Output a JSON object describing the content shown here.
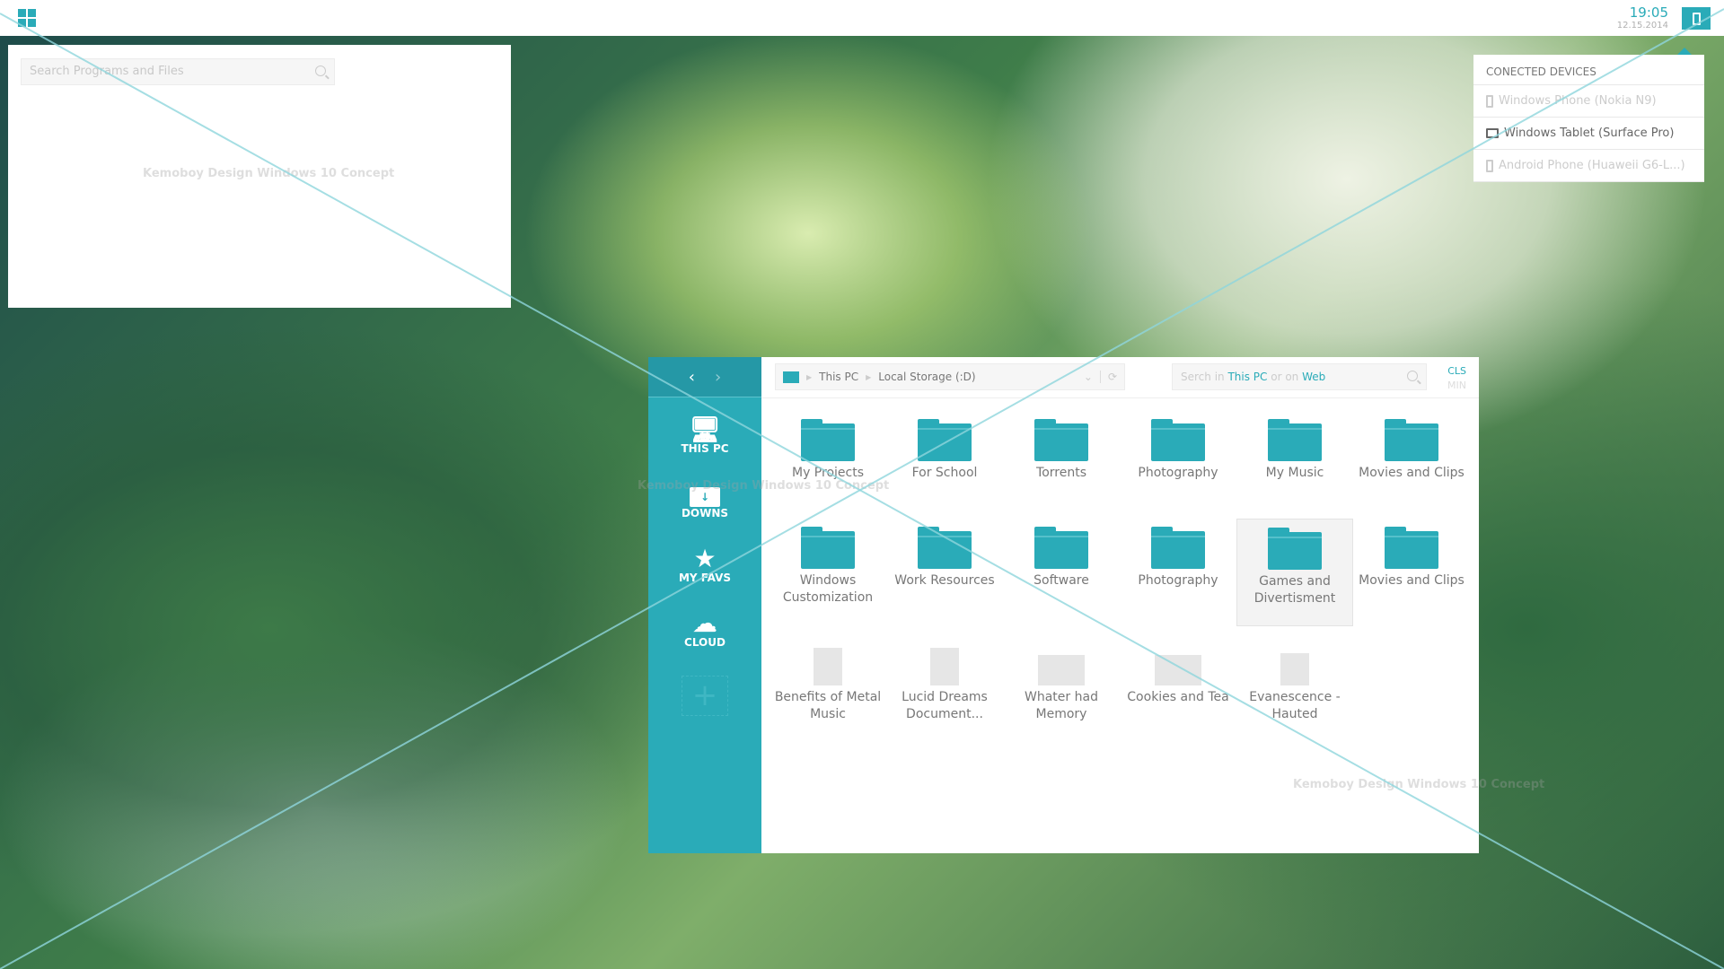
{
  "taskbar": {
    "start_icon": "windows-logo-icon",
    "time": "19:05",
    "date": "12.15.2014",
    "devices_icon": "phone-icon"
  },
  "start_panel": {
    "search_placeholder": "Search Programs and Files",
    "watermark": "Kemoboy Design Windows 10 Concept"
  },
  "devices": {
    "title": "CONECTED DEVICES",
    "items": [
      {
        "label": "Windows Phone (Nokia N9)",
        "icon": "phone-icon",
        "active": false
      },
      {
        "label": "Windows Tablet (Surface Pro)",
        "icon": "tablet-icon",
        "active": true
      },
      {
        "label": "Android Phone (Huaweii G6-L...)",
        "icon": "phone-icon",
        "active": false
      }
    ]
  },
  "explorer": {
    "sidebar": [
      {
        "label": "THIS PC",
        "icon": "computer-icon"
      },
      {
        "label": "DOWNS",
        "icon": "download-folder-icon"
      },
      {
        "label": "MY FAVS",
        "icon": "star-icon"
      },
      {
        "label": "CLOUD",
        "icon": "cloud-icon"
      }
    ],
    "add_label": "+",
    "breadcrumb": [
      "This PC",
      "Local Storage (:D)"
    ],
    "search": {
      "prefix": "Serch in",
      "scope1": "This PC",
      "mid": "or on",
      "scope2": "Web"
    },
    "close_label": "CLS",
    "min_label": "MIN",
    "folders": [
      "My Projects",
      "For School",
      "Torrents",
      "Photography",
      "My Music",
      "Movies and Clips",
      "Windows Customization",
      "Work Resources",
      "Software",
      "Photography",
      "Games and Divertisment",
      "Movies and Clips"
    ],
    "selected": "Games and Divertisment",
    "files": [
      {
        "name": "Benefits of Metal Music",
        "type": "document"
      },
      {
        "name": "Lucid Dreams Document...",
        "type": "document"
      },
      {
        "name": "Whater had Memory",
        "type": "video"
      },
      {
        "name": "Cookies and Tea",
        "type": "image"
      },
      {
        "name": "Evanescence - Hauted",
        "type": "audio"
      }
    ],
    "watermark": "Kemoboy Design Windows 10 Concept"
  },
  "accent_color": "#2aabb8"
}
